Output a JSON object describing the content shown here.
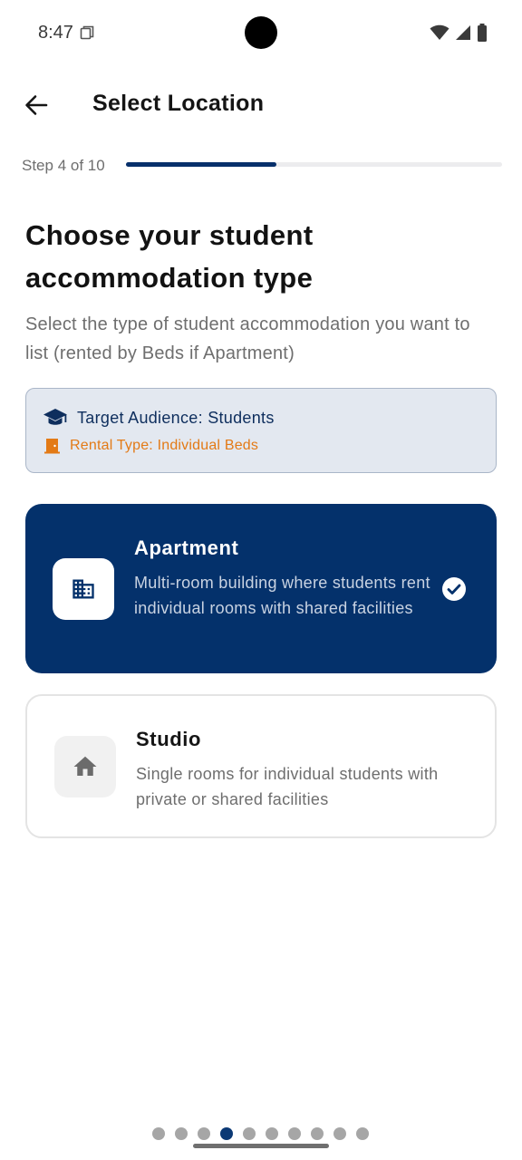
{
  "status_bar": {
    "time": "8:47",
    "icons": [
      "sim-card-icon",
      "wifi-icon",
      "cellular-signal-icon",
      "battery-icon"
    ]
  },
  "app_bar": {
    "back_icon": "arrow-left-icon",
    "title": "Select Location"
  },
  "progress": {
    "step_label": "Step 4 of 10",
    "current_step": 4,
    "total_steps": 10,
    "fraction": 0.4
  },
  "main": {
    "headline": "Choose your student accommodation type",
    "subtitle": "Select the type of student accommodation you want to list (rented by Beds if Apartment)"
  },
  "info_box": {
    "audience_icon": "graduation-cap-icon",
    "audience_text": "Target Audience: Students",
    "rental_icon": "door-icon",
    "rental_text": "Rental Type: Individual Beds"
  },
  "options": [
    {
      "title": "Apartment",
      "description": "Multi-room building where students rent individual rooms with shared facilities",
      "icon": "building-icon",
      "selected": true
    },
    {
      "title": "Studio",
      "description": "Single rooms for individual students with private or shared facilities",
      "icon": "home-icon",
      "selected": false
    }
  ],
  "pagination": {
    "total": 10,
    "active_index": 3
  },
  "colors": {
    "primary": "#04316b",
    "accent_orange": "#e37a16",
    "info_bg": "#e3e8f0",
    "text_dark": "#121212",
    "text_muted": "#6e6e6e"
  }
}
